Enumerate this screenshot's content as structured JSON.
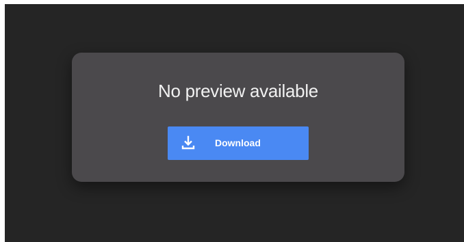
{
  "preview": {
    "message": "No preview available",
    "download_label": "Download",
    "download_icon": "download-icon"
  },
  "colors": {
    "viewer_background": "#252525",
    "card_background": "#4b494c",
    "button_background": "#4a89f3",
    "text": "#f1f1f1"
  }
}
